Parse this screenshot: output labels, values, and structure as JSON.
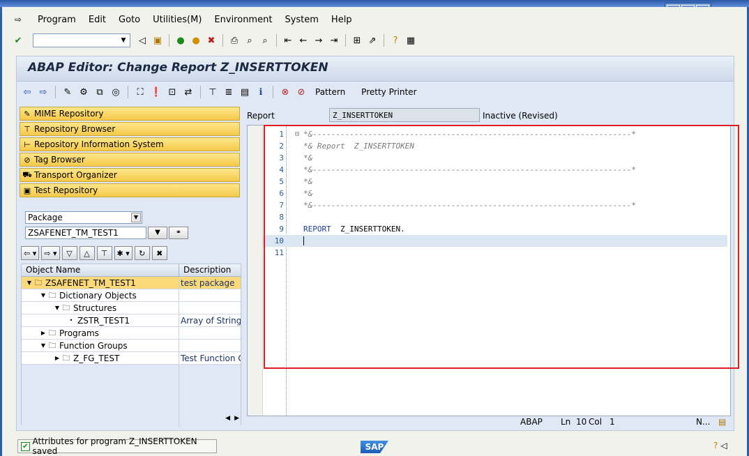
{
  "menu": [
    "Program",
    "Edit",
    "Goto",
    "Utilities(M)",
    "Environment",
    "System",
    "Help"
  ],
  "screen_title": "ABAP Editor: Change Report Z_INSERTTOKEN",
  "app_toolbar": {
    "pattern": "Pattern",
    "pretty_printer": "Pretty Printer"
  },
  "nav_buttons": [
    "MIME Repository",
    "Repository Browser",
    "Repository Information System",
    "Tag Browser",
    "Transport Organizer",
    "Test Repository"
  ],
  "object_selector": {
    "type": "Package",
    "name": "ZSAFENET_TM_TEST1"
  },
  "tree": {
    "columns": [
      "Object Name",
      "Description"
    ],
    "rows": [
      {
        "name": "ZSAFENET_TM_TEST1",
        "desc": "test package",
        "level": 0,
        "expanded": true,
        "selected": true
      },
      {
        "name": "Dictionary Objects",
        "desc": "",
        "level": 1,
        "expanded": true
      },
      {
        "name": "Structures",
        "desc": "",
        "level": 2,
        "expanded": true
      },
      {
        "name": "ZSTR_TEST1",
        "desc": "Array of Strings",
        "level": 3,
        "leaf": true
      },
      {
        "name": "Programs",
        "desc": "",
        "level": 1,
        "expanded": false
      },
      {
        "name": "Function Groups",
        "desc": "",
        "level": 1,
        "expanded": true
      },
      {
        "name": "Z_FG_TEST",
        "desc": "Test Function G",
        "level": 2,
        "expanded": false
      }
    ]
  },
  "report": {
    "label": "Report",
    "name": "Z_INSERTTOKEN",
    "status": "Inactive (Revised)"
  },
  "code": [
    {
      "n": "1",
      "text": "*&---------------------------------------------------------------------*",
      "type": "comment"
    },
    {
      "n": "2",
      "text": "*& Report  Z_INSERTTOKEN",
      "type": "comment"
    },
    {
      "n": "3",
      "text": "*&",
      "type": "comment"
    },
    {
      "n": "4",
      "text": "*&---------------------------------------------------------------------*",
      "type": "comment"
    },
    {
      "n": "5",
      "text": "*&",
      "type": "comment"
    },
    {
      "n": "6",
      "text": "*&",
      "type": "comment"
    },
    {
      "n": "7",
      "text": "*&---------------------------------------------------------------------*",
      "type": "comment"
    },
    {
      "n": "8",
      "text": "",
      "type": "plain"
    },
    {
      "n": "9",
      "text": "REPORT  Z_INSERTTOKEN.",
      "type": "report"
    },
    {
      "n": "10",
      "text": "",
      "type": "plain",
      "current": true
    },
    {
      "n": "11",
      "text": "",
      "type": "plain"
    }
  ],
  "editor_status": {
    "lang": "ABAP",
    "ln_label": "Ln",
    "ln": "10",
    "col_label": "Col",
    "col": "1",
    "mode": "N..."
  },
  "status_message": "Attributes for program Z_INSERTTOKEN saved",
  "logo_text": "SAP"
}
